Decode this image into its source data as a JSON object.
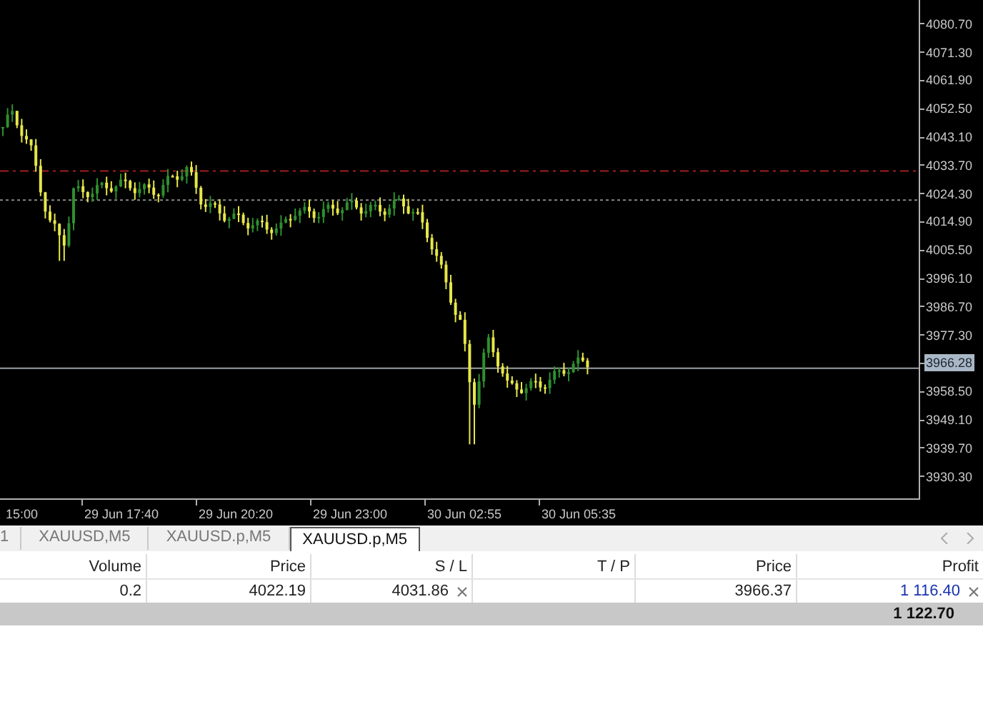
{
  "chart": {
    "price_axis": [
      {
        "label": "4080.70",
        "kind": "tick"
      },
      {
        "label": "4071.30",
        "kind": "tick"
      },
      {
        "label": "4061.90",
        "kind": "tick"
      },
      {
        "label": "4052.50",
        "kind": "tick"
      },
      {
        "label": "4043.10",
        "kind": "tick"
      },
      {
        "label": "4033.70",
        "kind": "tick"
      },
      {
        "label": "4024.30",
        "kind": "tick"
      },
      {
        "label": "4014.90",
        "kind": "tick"
      },
      {
        "label": "4005.50",
        "kind": "tick"
      },
      {
        "label": "3996.10",
        "kind": "tick"
      },
      {
        "label": "3986.70",
        "kind": "tick"
      },
      {
        "label": "3977.30",
        "kind": "tick"
      },
      {
        "label": "3966.28",
        "kind": "current"
      },
      {
        "label": "3958.50",
        "kind": "tick"
      },
      {
        "label": "3949.10",
        "kind": "tick"
      },
      {
        "label": "3939.70",
        "kind": "tick"
      },
      {
        "label": "3930.30",
        "kind": "tick"
      }
    ],
    "time_axis": [
      "15:00",
      "29 Jun 17:40",
      "29 Jun 20:20",
      "29 Jun 23:00",
      "30 Jun 02:55",
      "30 Jun 05:35"
    ]
  },
  "tabs": [
    {
      "label": "1",
      "selected": false
    },
    {
      "label": "XAUUSD,M5",
      "selected": false
    },
    {
      "label": "XAUUSD.p,M5",
      "selected": false
    },
    {
      "label": "XAUUSD.p,M5",
      "selected": true
    }
  ],
  "table": {
    "columns": [
      "Volume",
      "Price",
      "S / L",
      "T / P",
      "Price",
      "Profit"
    ],
    "rows": [
      {
        "cells": [
          "0.2",
          "4022.19",
          "4031.86",
          "",
          "3966.37",
          "1 116.40"
        ]
      }
    ],
    "total": "1 122.70"
  }
}
